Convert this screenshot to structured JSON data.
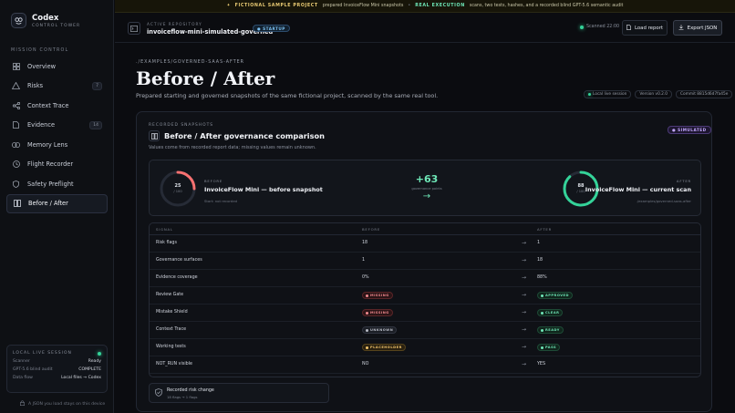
{
  "colors": {
    "accent_green": "#34d399",
    "accent_red": "#f87171",
    "accent_purple": "#c4a8ff",
    "accent_blue": "#7cc0f0"
  },
  "brand": {
    "title": "Codex",
    "subtitle": "CONTROL TOWER"
  },
  "sidebar": {
    "section_label": "MISSION CONTROL",
    "items": [
      {
        "label": "Overview",
        "icon": "grid-icon",
        "badge": ""
      },
      {
        "label": "Risks",
        "icon": "warning-icon",
        "badge": "7"
      },
      {
        "label": "Context Trace",
        "icon": "share-icon",
        "badge": ""
      },
      {
        "label": "Evidence",
        "icon": "file-icon",
        "badge": "14"
      },
      {
        "label": "Memory Lens",
        "icon": "link-icon",
        "badge": ""
      },
      {
        "label": "Flight Recorder",
        "icon": "clock-icon",
        "badge": ""
      },
      {
        "label": "Safety Preflight",
        "icon": "shield-icon",
        "badge": ""
      },
      {
        "label": "Before / After",
        "icon": "compare-icon",
        "badge": ""
      }
    ],
    "active_index": 7
  },
  "session": {
    "title": "LOCAL LIVE SESSION",
    "rows": [
      {
        "k": "Scanner",
        "v": "Ready"
      },
      {
        "k": "GPT-5.6 blind audit",
        "v": "COMPLETE"
      },
      {
        "k": "Data flow",
        "v": "Local files → Codex"
      }
    ]
  },
  "footer_note": "A JSON you load stays on this device",
  "banner": {
    "label1": "FICTIONAL SAMPLE PROJECT",
    "text1": "prepared InvoiceFlow Mini snapshots",
    "sep": "•",
    "label2": "REAL EXECUTION",
    "text2": "scans, two tests, hashes, and a recorded blind GPT-5.6 semantic audit"
  },
  "topbar": {
    "repo_label": "ACTIVE REPOSITORY",
    "repo_name": "invoiceflow-mini-simulated-governed",
    "startup_label": "STARTUP",
    "scanned": "Scanned 22:00",
    "load_label": "Load report",
    "export_label": "Export JSON"
  },
  "page": {
    "breadcrumb": "./EXAMPLES/GOVERNED-SAAS-AFTER",
    "title": "Before / After",
    "subtitle": "Prepared starting and governed snapshots of the same fictional project, scanned by the same real tool.",
    "meta": [
      "Local live session",
      "Version v0.2.0",
      "Commit 8815d6d7fa45e"
    ]
  },
  "comparison": {
    "section_label": "RECORDED SNAPSHOTS",
    "title": "Before / After governance comparison",
    "subtitle": "Values come from recorded report data; missing values remain unknown.",
    "simulated_label": "SIMULATED",
    "before": {
      "score": "25",
      "score_den": "/ 100",
      "score_value": 25,
      "label": "BEFORE",
      "title": "InvoiceFlow Mini — before snapshot",
      "note": "Start: not recorded"
    },
    "delta": {
      "value": "+63",
      "label": "governance points"
    },
    "after": {
      "score": "88",
      "score_den": "/ 100",
      "score_value": 88,
      "label": "AFTER",
      "title": "InvoiceFlow Mini — current scan",
      "note": "./examples/governed-saas-after"
    }
  },
  "table": {
    "headers": {
      "signal": "SIGNAL",
      "before": "BEFORE",
      "after": "AFTER"
    },
    "rows": [
      {
        "signal": "Risk flags",
        "before": "18",
        "before_type": "text",
        "after": "1",
        "after_type": "text"
      },
      {
        "signal": "Governance surfaces",
        "before": "1",
        "before_type": "text",
        "after": "18",
        "after_type": "text"
      },
      {
        "signal": "Evidence coverage",
        "before": "0%",
        "before_type": "text",
        "after": "88%",
        "after_type": "text"
      },
      {
        "signal": "Review Gate",
        "before": "MISSING",
        "before_type": "red",
        "after": "APPROVED",
        "after_type": "green"
      },
      {
        "signal": "Mistake Shield",
        "before": "MISSING",
        "before_type": "red",
        "after": "CLEAR",
        "after_type": "green"
      },
      {
        "signal": "Context Trace",
        "before": "UNKNOWN",
        "before_type": "gray",
        "after": "READY",
        "after_type": "green"
      },
      {
        "signal": "Working tests",
        "before": "PLACEHOLDER",
        "before_type": "amber",
        "after": "PASS",
        "after_type": "green"
      },
      {
        "signal": "NOT_RUN visible",
        "before": "NO",
        "before_type": "text",
        "after": "YES",
        "after_type": "text"
      }
    ]
  },
  "risk_change": {
    "title": "Recorded risk change",
    "sub": "18 flags → 1 flags"
  }
}
